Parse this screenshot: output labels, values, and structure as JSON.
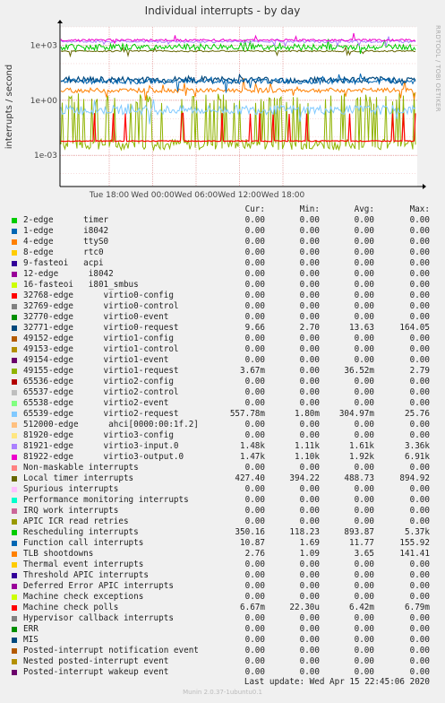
{
  "chart_data": {
    "type": "line",
    "title": "Individual interrupts - by day",
    "ylabel": "interrupts / second",
    "yscale": "log",
    "ylim": [
      2e-05,
      10000
    ],
    "yticks": [
      {
        "v": 1000,
        "label": "1e+03"
      },
      {
        "v": 1,
        "label": "1e+00"
      },
      {
        "v": 0.001,
        "label": "1e-03"
      }
    ],
    "xticks": [
      "Tue 18:00",
      "Wed 00:00",
      "Wed 06:00",
      "Wed 12:00",
      "Wed 18:00"
    ],
    "side_text": "RRDTOOL / TOBI OETIKER",
    "columns": [
      "Cur:",
      "Min:",
      "Avg:",
      "Max:"
    ],
    "series": [
      {
        "name": "2-edge      timer",
        "color": "#00cc00",
        "cur": "0.00",
        "min": "0.00",
        "avg": "0.00",
        "max": "0.00"
      },
      {
        "name": "1-edge      i8042",
        "color": "#0066b3",
        "cur": "0.00",
        "min": "0.00",
        "avg": "0.00",
        "max": "0.00"
      },
      {
        "name": "4-edge      ttyS0",
        "color": "#ff8000",
        "cur": "0.00",
        "min": "0.00",
        "avg": "0.00",
        "max": "0.00"
      },
      {
        "name": "8-edge      rtc0",
        "color": "#ffcc00",
        "cur": "0.00",
        "min": "0.00",
        "avg": "0.00",
        "max": "0.00"
      },
      {
        "name": "9-fasteoi   acpi",
        "color": "#330099",
        "cur": "0.00",
        "min": "0.00",
        "avg": "0.00",
        "max": "0.00"
      },
      {
        "name": "12-edge      i8042",
        "color": "#990099",
        "cur": "0.00",
        "min": "0.00",
        "avg": "0.00",
        "max": "0.00"
      },
      {
        "name": "16-fasteoi   i801_smbus",
        "color": "#ccff00",
        "cur": "0.00",
        "min": "0.00",
        "avg": "0.00",
        "max": "0.00"
      },
      {
        "name": "32768-edge      virtio0-config",
        "color": "#ff0000",
        "cur": "0.00",
        "min": "0.00",
        "avg": "0.00",
        "max": "0.00"
      },
      {
        "name": "32769-edge      virtio0-control",
        "color": "#808080",
        "cur": "0.00",
        "min": "0.00",
        "avg": "0.00",
        "max": "0.00"
      },
      {
        "name": "32770-edge      virtio0-event",
        "color": "#008f00",
        "cur": "0.00",
        "min": "0.00",
        "avg": "0.00",
        "max": "0.00"
      },
      {
        "name": "32771-edge      virtio0-request",
        "color": "#00487d",
        "cur": "9.66",
        "min": "2.70",
        "avg": "13.63",
        "max": "164.05"
      },
      {
        "name": "49152-edge      virtio1-config",
        "color": "#b35a00",
        "cur": "0.00",
        "min": "0.00",
        "avg": "0.00",
        "max": "0.00"
      },
      {
        "name": "49153-edge      virtio1-control",
        "color": "#b38f00",
        "cur": "0.00",
        "min": "0.00",
        "avg": "0.00",
        "max": "0.00"
      },
      {
        "name": "49154-edge      virtio1-event",
        "color": "#6b006b",
        "cur": "0.00",
        "min": "0.00",
        "avg": "0.00",
        "max": "0.00"
      },
      {
        "name": "49155-edge      virtio1-request",
        "color": "#8fb300",
        "cur": "3.67m",
        "min": "0.00",
        "avg": "36.52m",
        "max": "2.79"
      },
      {
        "name": "65536-edge      virtio2-config",
        "color": "#b30000",
        "cur": "0.00",
        "min": "0.00",
        "avg": "0.00",
        "max": "0.00"
      },
      {
        "name": "65537-edge      virtio2-control",
        "color": "#bebebe",
        "cur": "0.00",
        "min": "0.00",
        "avg": "0.00",
        "max": "0.00"
      },
      {
        "name": "65538-edge      virtio2-event",
        "color": "#80ff80",
        "cur": "0.00",
        "min": "0.00",
        "avg": "0.00",
        "max": "0.00"
      },
      {
        "name": "65539-edge      virtio2-request",
        "color": "#80c9ff",
        "cur": "557.78m",
        "min": "1.80m",
        "avg": "304.97m",
        "max": "25.76"
      },
      {
        "name": "512000-edge      ahci[0000:00:1f.2]",
        "color": "#ffc080",
        "cur": "0.00",
        "min": "0.00",
        "avg": "0.00",
        "max": "0.00"
      },
      {
        "name": "81920-edge      virtio3-config",
        "color": "#ffe680",
        "cur": "0.00",
        "min": "0.00",
        "avg": "0.00",
        "max": "0.00"
      },
      {
        "name": "81921-edge      virtio3-input.0",
        "color": "#aa80ff",
        "cur": "1.48k",
        "min": "1.11k",
        "avg": "1.61k",
        "max": "3.36k"
      },
      {
        "name": "81922-edge      virtio3-output.0",
        "color": "#ee00cc",
        "cur": "1.47k",
        "min": "1.10k",
        "avg": "1.92k",
        "max": "6.91k"
      },
      {
        "name": "Non-maskable interrupts",
        "color": "#ff8080",
        "cur": "0.00",
        "min": "0.00",
        "avg": "0.00",
        "max": "0.00"
      },
      {
        "name": "Local timer interrupts",
        "color": "#666600",
        "cur": "427.40",
        "min": "394.22",
        "avg": "488.73",
        "max": "894.92"
      },
      {
        "name": "Spurious interrupts",
        "color": "#ffbfff",
        "cur": "0.00",
        "min": "0.00",
        "avg": "0.00",
        "max": "0.00"
      },
      {
        "name": "Performance monitoring interrupts",
        "color": "#00ffcc",
        "cur": "0.00",
        "min": "0.00",
        "avg": "0.00",
        "max": "0.00"
      },
      {
        "name": "IRQ work interrupts",
        "color": "#cc6699",
        "cur": "0.00",
        "min": "0.00",
        "avg": "0.00",
        "max": "0.00"
      },
      {
        "name": "APIC ICR read retries",
        "color": "#999900",
        "cur": "0.00",
        "min": "0.00",
        "avg": "0.00",
        "max": "0.00"
      },
      {
        "name": "Rescheduling interrupts",
        "color": "#00cc00",
        "cur": "350.16",
        "min": "118.23",
        "avg": "893.87",
        "max": "5.37k"
      },
      {
        "name": "Function call interrupts",
        "color": "#0066b3",
        "cur": "10.87",
        "min": "1.69",
        "avg": "11.77",
        "max": "155.92"
      },
      {
        "name": "TLB shootdowns",
        "color": "#ff8000",
        "cur": "2.76",
        "min": "1.09",
        "avg": "3.65",
        "max": "141.41"
      },
      {
        "name": "Thermal event interrupts",
        "color": "#ffcc00",
        "cur": "0.00",
        "min": "0.00",
        "avg": "0.00",
        "max": "0.00"
      },
      {
        "name": "Threshold APIC interrupts",
        "color": "#330099",
        "cur": "0.00",
        "min": "0.00",
        "avg": "0.00",
        "max": "0.00"
      },
      {
        "name": "Deferred Error APIC interrupts",
        "color": "#990099",
        "cur": "0.00",
        "min": "0.00",
        "avg": "0.00",
        "max": "0.00"
      },
      {
        "name": "Machine check exceptions",
        "color": "#ccff00",
        "cur": "0.00",
        "min": "0.00",
        "avg": "0.00",
        "max": "0.00"
      },
      {
        "name": "Machine check polls",
        "color": "#ff0000",
        "cur": "6.67m",
        "min": "22.30u",
        "avg": "6.42m",
        "max": "6.79m"
      },
      {
        "name": "Hypervisor callback interrupts",
        "color": "#808080",
        "cur": "0.00",
        "min": "0.00",
        "avg": "0.00",
        "max": "0.00"
      },
      {
        "name": "ERR",
        "color": "#008f00",
        "cur": "0.00",
        "min": "0.00",
        "avg": "0.00",
        "max": "0.00"
      },
      {
        "name": "MIS",
        "color": "#00487d",
        "cur": "0.00",
        "min": "0.00",
        "avg": "0.00",
        "max": "0.00"
      },
      {
        "name": "Posted-interrupt notification event",
        "color": "#b35a00",
        "cur": "0.00",
        "min": "0.00",
        "avg": "0.00",
        "max": "0.00"
      },
      {
        "name": "Nested posted-interrupt event",
        "color": "#b38f00",
        "cur": "0.00",
        "min": "0.00",
        "avg": "0.00",
        "max": "0.00"
      },
      {
        "name": "Posted-interrupt wakeup event",
        "color": "#6b006b",
        "cur": "0.00",
        "min": "0.00",
        "avg": "0.00",
        "max": "0.00"
      }
    ]
  },
  "last_update": "Last update: Wed Apr 15 22:45:06 2020",
  "footer": "Munin 2.0.37-1ubuntu0.1"
}
